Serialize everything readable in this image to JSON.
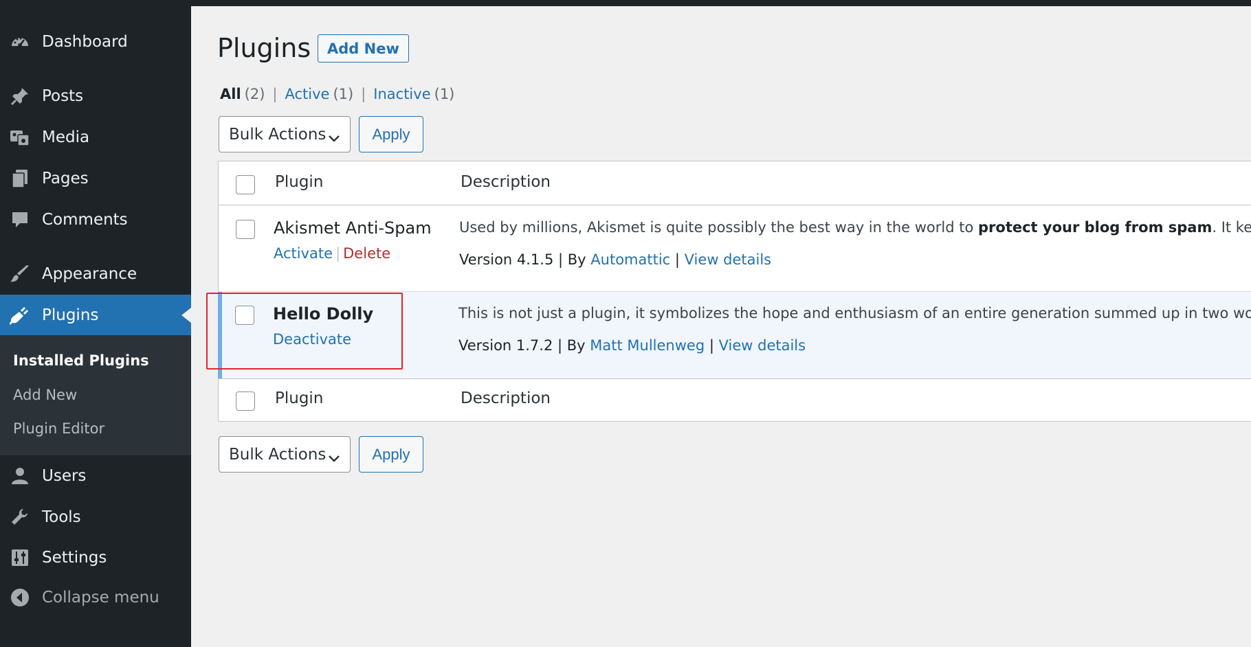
{
  "sidebar": {
    "items": [
      {
        "label": "Dashboard",
        "icon": "dashboard-icon"
      },
      {
        "label": "Posts",
        "icon": "pushpin-icon"
      },
      {
        "label": "Media",
        "icon": "media-icon"
      },
      {
        "label": "Pages",
        "icon": "pages-icon"
      },
      {
        "label": "Comments",
        "icon": "comment-icon"
      },
      {
        "label": "Appearance",
        "icon": "paintbrush-icon"
      },
      {
        "label": "Plugins",
        "icon": "plugin-icon"
      },
      {
        "label": "Users",
        "icon": "user-icon"
      },
      {
        "label": "Tools",
        "icon": "wrench-icon"
      },
      {
        "label": "Settings",
        "icon": "settings-sliders-icon"
      },
      {
        "label": "Collapse menu",
        "icon": "collapse-arrow-icon"
      }
    ],
    "submenu": [
      "Installed Plugins",
      "Add New",
      "Plugin Editor"
    ]
  },
  "header": {
    "title": "Plugins",
    "add_new": "Add New"
  },
  "filters": {
    "all": "All",
    "all_count": "(2)",
    "active": "Active",
    "active_count": "(1)",
    "inactive": "Inactive",
    "inactive_count": "(1)",
    "sep": "|"
  },
  "bulk": {
    "label": "Bulk Actions",
    "apply": "Apply"
  },
  "table": {
    "col_plugin": "Plugin",
    "col_description": "Description",
    "rows": [
      {
        "name": "Akismet Anti-Spam",
        "action1": "Activate",
        "action2": "Delete",
        "desc_pre": "Used by millions, Akismet is quite possibly the best way in the world to ",
        "desc_bold": "protect your blog from spam",
        "desc_post": ". It keeps your",
        "version": "Version 4.1.5 | By ",
        "author": "Automattic",
        "sep": " | ",
        "details": "View details"
      },
      {
        "name": "Hello Dolly",
        "action1": "Deactivate",
        "desc": "This is not just a plugin, it symbolizes the hope and enthusiasm of an entire generation summed up in two words su",
        "version": "Version 1.7.2 | By ",
        "author": "Matt Mullenweg",
        "sep": " | ",
        "details": "View details"
      }
    ]
  },
  "colors": {
    "sidebar_bg": "#1d2327",
    "accent": "#2271b1",
    "delete": "#b32d2e",
    "highlight_box": "#e0252a"
  }
}
